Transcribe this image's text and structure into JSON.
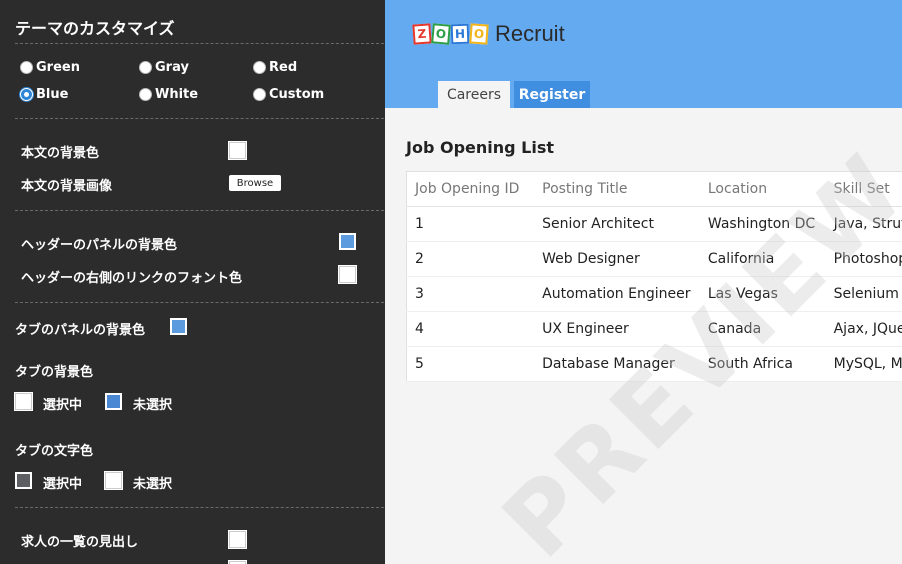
{
  "panel": {
    "title": "テーマのカスタマイズ",
    "themes": [
      {
        "label": "Green",
        "checked": false
      },
      {
        "label": "Gray",
        "checked": false
      },
      {
        "label": "Red",
        "checked": false
      },
      {
        "label": "Blue",
        "checked": true
      },
      {
        "label": "White",
        "checked": false
      },
      {
        "label": "Custom",
        "checked": false
      }
    ],
    "body_bg_color": "本文の背景色",
    "body_bg_image": "本文の背景画像",
    "browse_label": "Browse",
    "header_panel_bg": "ヘッダーのパネルの背景色",
    "header_link_font": "ヘッダーの右側のリンクのフォント色",
    "tab_panel_bg": "タブのパネルの背景色",
    "tab_bg_heading": "タブの背景色",
    "tab_text_heading": "タブの文字色",
    "selected_label": "選択中",
    "unselected_label": "未選択",
    "job_list_heading": "求人の一覧の見出し"
  },
  "preview": {
    "logo_letters": [
      "Z",
      "O",
      "H",
      "O"
    ],
    "logo_colors": [
      "#e5372b",
      "#2e9e46",
      "#2b78d8",
      "#f2b51b"
    ],
    "product": "Recruit",
    "tabs": {
      "careers": "Careers",
      "register": "Register"
    },
    "list_title": "Job Opening List",
    "columns": [
      "Job Opening ID",
      "Posting Title",
      "Location",
      "Skill Set"
    ],
    "rows": [
      [
        "1",
        "Senior Architect",
        "Washington DC",
        "Java, Struts"
      ],
      [
        "2",
        "Web Designer",
        "California",
        "Photoshop"
      ],
      [
        "3",
        "Automation Engineer",
        "Las Vegas",
        "Selenium"
      ],
      [
        "4",
        "UX Engineer",
        "Canada",
        "Ajax, JQuery"
      ],
      [
        "5",
        "Database Manager",
        "South Africa",
        "MySQL, MS"
      ]
    ],
    "watermark": "PREVIEW"
  }
}
